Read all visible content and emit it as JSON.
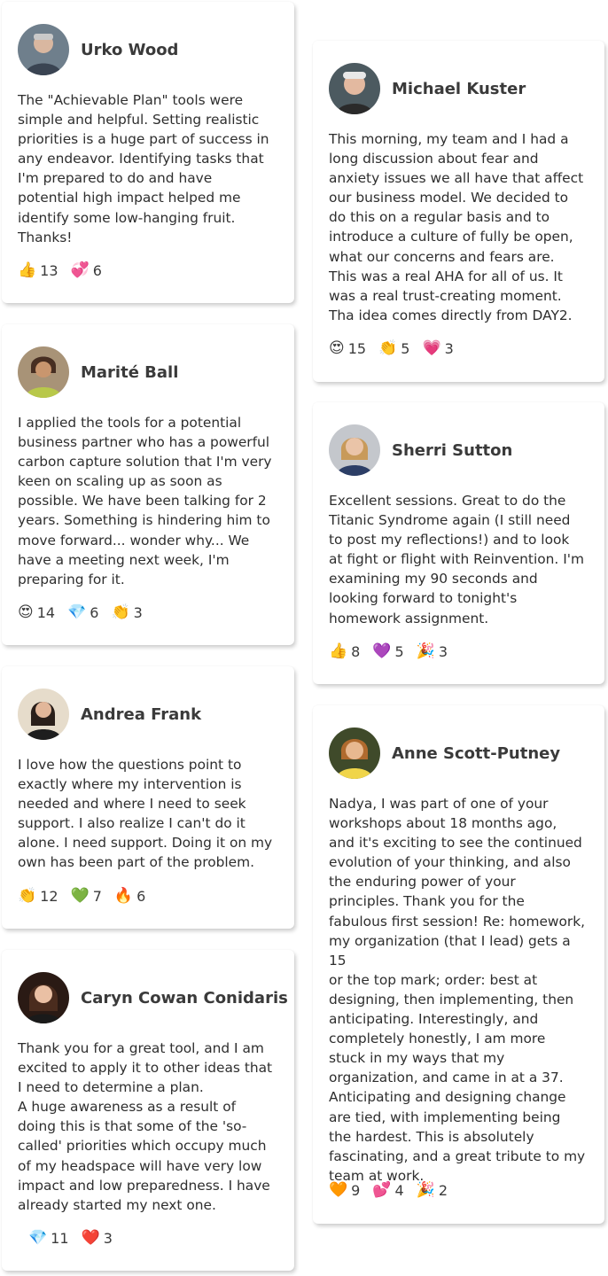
{
  "testimonials": [
    {
      "name": "Urko Wood",
      "avatar_color": "#7d8c99",
      "avatar_icon": "avatar-urko-wood",
      "text": [
        "The \"Achievable Plan\" tools were",
        "simple and helpful. Setting realistic",
        "priorities is a huge part of success in",
        "any endeavor. Identifying tasks that",
        "I'm prepared to do and have",
        "potential high impact helped me",
        "identify some low-hanging fruit.",
        "Thanks!"
      ],
      "reactions": [
        {
          "icon": "thumbs-up-icon",
          "emoji": "👍",
          "count": "13"
        },
        {
          "icon": "sparkling-heart-icon",
          "emoji": "💞",
          "count": "6"
        }
      ]
    },
    {
      "name": "Michael Kuster",
      "avatar_color": "#9aa2a8",
      "avatar_icon": "avatar-michael-kuster",
      "text": [
        "This morning, my team and I had a",
        "long discussion about fear and",
        "anxiety issues we all have that affect",
        "our business model. We decided to",
        "do this on a regular basis and to",
        "introduce a culture of fully be open,",
        "what our concerns and fears are.",
        "This was a real AHA for all of us. It",
        "was a real trust-creating moment.",
        "Tha idea comes directly from DAY2."
      ],
      "reactions": [
        {
          "icon": "heart-eyes-icon",
          "emoji": "😍",
          "count": "15"
        },
        {
          "icon": "clapping-hands-icon",
          "emoji": "👏",
          "count": "5"
        },
        {
          "icon": "pink-heart-icon",
          "emoji": "💗",
          "count": "3"
        }
      ]
    },
    {
      "name": "Marité Ball",
      "avatar_color": "#8a6a4a",
      "avatar_icon": "avatar-marite-ball",
      "text": [
        "I applied the tools for a potential",
        "business partner who has a powerful",
        "carbon capture solution that I'm very",
        "keen on scaling up as soon as",
        "possible. We have been talking for 2",
        "years. Something is hindering him to",
        "move forward... wonder why... We",
        "have a meeting next week, I'm",
        "preparing for it."
      ],
      "reactions": [
        {
          "icon": "heart-eyes-icon",
          "emoji": "😍",
          "count": "14"
        },
        {
          "icon": "gem-icon",
          "emoji": "💎",
          "count": "6"
        },
        {
          "icon": "clapping-hands-icon",
          "emoji": "👏",
          "count": "3"
        }
      ]
    },
    {
      "name": "Sherri Sutton",
      "avatar_color": "#b7bcc4",
      "avatar_icon": "avatar-sherri-sutton",
      "text": [
        "Excellent sessions. Great to do the",
        "Titanic Syndrome again (I still need",
        "to post my reflections!) and to look",
        "at fight or flight with Reinvention. I'm",
        "examining my 90 seconds and",
        "looking forward to tonight's",
        "homework assignment."
      ],
      "reactions": [
        {
          "icon": "thumbs-up-icon",
          "emoji": "👍",
          "count": "8"
        },
        {
          "icon": "purple-heart-icon",
          "emoji": "💜",
          "count": "5"
        },
        {
          "icon": "party-popper-icon",
          "emoji": "🎉",
          "count": "3"
        }
      ]
    },
    {
      "name": "Andrea Frank",
      "avatar_color": "#c9b79a",
      "avatar_icon": "avatar-andrea-frank",
      "text": [
        "I love how the questions point to",
        "exactly where my intervention is",
        "needed and where I need to seek",
        "support. I also realize I can't do it",
        "alone. I need support. Doing it on my",
        "own has been part of the problem."
      ],
      "reactions": [
        {
          "icon": "clapping-hands-icon",
          "emoji": "👏",
          "count": "12"
        },
        {
          "icon": "green-heart-icon",
          "emoji": "💚",
          "count": "7"
        },
        {
          "icon": "fire-icon",
          "emoji": "🔥",
          "count": "6"
        }
      ]
    },
    {
      "name": "Anne Scott-Putney",
      "avatar_color": "#5f6b3a",
      "avatar_icon": "avatar-anne-scott-putney",
      "text": [
        "Nadya, I was part of one of your",
        "workshops about 18 months ago,",
        "and it's exciting to see the continued",
        "evolution of your thinking, and also",
        "the enduring power of your",
        "principles. Thank you for the",
        "fabulous first session! Re: homework,",
        "my organization (that I lead) gets a 15",
        "or the top mark; order: best at",
        "designing, then implementing, then",
        "anticipating. Interestingly, and",
        "completely honestly, I am more",
        "stuck in my ways that my",
        "organization, and came in at a 37.",
        "Anticipating and designing change",
        "are tied, with implementing being",
        "the hardest. This is absolutely",
        "fascinating, and a great tribute to my",
        "team at work."
      ],
      "reactions": [
        {
          "icon": "orange-heart-icon",
          "emoji": "🧡",
          "count": "9"
        },
        {
          "icon": "sparkling-heart-icon",
          "emoji": "💕",
          "count": "4"
        },
        {
          "icon": "party-popper-icon",
          "emoji": "🎉",
          "count": "2"
        }
      ]
    },
    {
      "name": "Caryn Cowan Conidaris",
      "avatar_color": "#5a3b2e",
      "avatar_icon": "avatar-caryn-cowan-conidaris",
      "text": [
        "Thank you for a great tool, and I am",
        "excited to apply it to other ideas that",
        "I need to determine a plan.",
        "A huge awareness as a result of",
        "doing this is that some of the 'so-",
        "called' priorities which occupy much",
        "of my headspace will have very low",
        "impact and low preparedness. I have",
        "already started my next one."
      ],
      "reactions": [
        {
          "icon": "gem-icon",
          "emoji": "💎",
          "count": "11"
        },
        {
          "icon": "red-heart-icon",
          "emoji": "❤️",
          "count": "3"
        }
      ]
    }
  ]
}
